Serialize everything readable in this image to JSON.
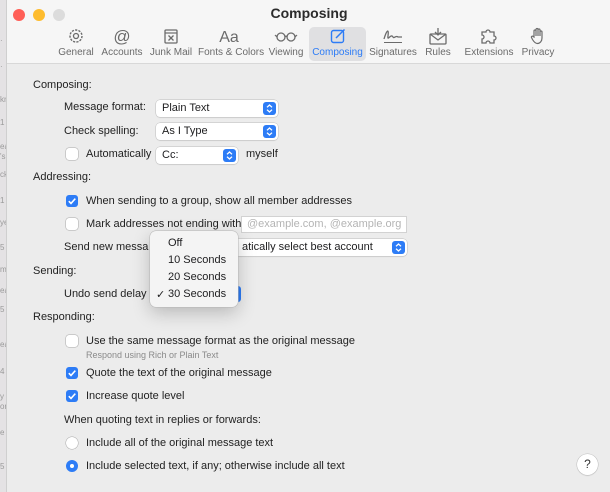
{
  "window": {
    "title": "Composing",
    "traffic_colors": [
      "#ff5f57",
      "#febc2e",
      "#dcdcdc"
    ]
  },
  "toolbar": {
    "items": [
      {
        "label": "General",
        "icon": "gear-icon"
      },
      {
        "label": "Accounts",
        "icon": "at-sign-icon"
      },
      {
        "label": "Junk Mail",
        "icon": "junk-mail-icon"
      },
      {
        "label": "Fonts & Colors",
        "icon": "fonts-icon"
      },
      {
        "label": "Viewing",
        "icon": "glasses-icon"
      },
      {
        "label": "Composing",
        "icon": "compose-icon",
        "selected": true
      },
      {
        "label": "Signatures",
        "icon": "signature-icon"
      },
      {
        "label": "Rules",
        "icon": "rules-icon"
      },
      {
        "label": "Extensions",
        "icon": "puzzle-icon"
      },
      {
        "label": "Privacy",
        "icon": "hand-icon"
      }
    ]
  },
  "composing": {
    "section": "Composing:",
    "message_format_label": "Message format:",
    "message_format_value": "Plain Text",
    "check_spelling_label": "Check spelling:",
    "check_spelling_value": "As I Type",
    "auto_label": "Automatically",
    "auto_value": "Cc:",
    "auto_suffix": "myself",
    "auto_checked": false
  },
  "addressing": {
    "section": "Addressing:",
    "group_label": "When sending to a group, show all member addresses",
    "group_checked": true,
    "mark_label": "Mark addresses not ending with",
    "mark_checked": false,
    "mark_placeholder": "@example.com, @example.org",
    "send_new_label": "Send new messa",
    "send_new_value": "atically select best account"
  },
  "sending": {
    "section": "Sending:",
    "undo_label": "Undo send delay"
  },
  "undo_menu": {
    "options": [
      "Off",
      "10 Seconds",
      "20 Seconds",
      "30 Seconds"
    ],
    "selected": "30 Seconds",
    "check_glyph": "✓"
  },
  "responding": {
    "section": "Responding:",
    "same_format_label": "Use the same message format as the original message",
    "same_format_checked": false,
    "same_format_hint": "Respond using Rich or Plain Text",
    "quote_label": "Quote the text of the original message",
    "quote_checked": true,
    "increase_label": "Increase quote level",
    "increase_checked": true,
    "quoting_heading": "When quoting text in replies or forwards:",
    "include_all_label": "Include all of the original message text",
    "include_selected_label": "Include selected text, if any; otherwise include all text",
    "include_choice": "selected"
  },
  "help_label": "?",
  "behind_fragments": [
    "·",
    "·",
    "kr",
    "1",
    "ea",
    "'s",
    "ck",
    "1",
    "ye",
    "5",
    "m",
    "ea",
    "5",
    "ea",
    "4",
    "y",
    "or",
    "e",
    "5"
  ],
  "accent_color": "#2d7cf6"
}
